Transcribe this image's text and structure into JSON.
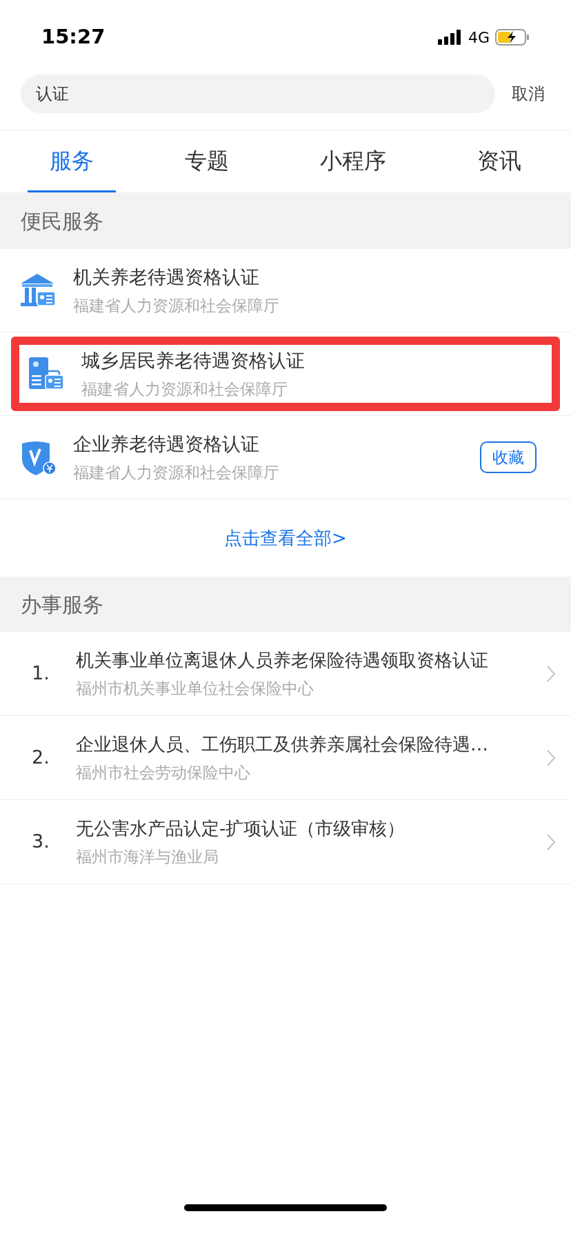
{
  "status_bar": {
    "time": "15:27",
    "network": "4G"
  },
  "search": {
    "value": "认证",
    "cancel": "取消"
  },
  "tabs": [
    {
      "label": "服务",
      "selected": true
    },
    {
      "label": "专题",
      "selected": false
    },
    {
      "label": "小程序",
      "selected": false
    },
    {
      "label": "资讯",
      "selected": false
    }
  ],
  "convenience_section": {
    "title": "便民服务",
    "items": [
      {
        "kind": "building",
        "title": "机关养老待遇资格认证",
        "subtitle": "福建省人力资源和社会保障厅",
        "highlighted": false
      },
      {
        "kind": "resident",
        "title": "城乡居民养老待遇资格认证",
        "subtitle": "福建省人力资源和社会保障厅",
        "highlighted": true
      },
      {
        "kind": "shield",
        "title": "企业养老待遇资格认证",
        "subtitle": "福建省人力资源和社会保障厅",
        "highlighted": false,
        "action": "收藏"
      }
    ],
    "view_all": "点击查看全部>"
  },
  "affairs_section": {
    "title": "办事服务",
    "items": [
      {
        "number": "1.",
        "title": "机关事业单位离退休人员养老保险待遇领取资格认证",
        "subtitle": "福州市机关事业单位社会保险中心"
      },
      {
        "number": "2.",
        "title": "企业退休人员、工伤职工及供养亲属社会保险待遇…",
        "subtitle": "福州市社会劳动保险中心"
      },
      {
        "number": "3.",
        "title": "无公害水产品认定-扩项认证（市级审核）",
        "subtitle": "福州市海洋与渔业局"
      }
    ]
  }
}
